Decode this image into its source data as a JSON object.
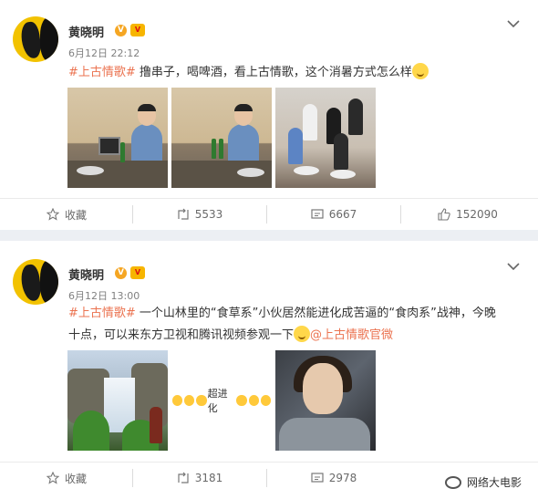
{
  "posts": [
    {
      "username": "黄晓明",
      "verified_badge": "V",
      "level_badge": "V",
      "timestamp": "6月12日 22:12",
      "hashtag": "#上古情歌#",
      "text": " 撸串子，喝啤酒，看上古情歌，这个消暑方式怎么样",
      "actions": {
        "favorite": "收藏",
        "repost": "5533",
        "comment": "6667",
        "like": "152090"
      }
    },
    {
      "username": "黄晓明",
      "verified_badge": "V",
      "level_badge": "V",
      "timestamp": "6月12日 13:00",
      "hashtag": "#上古情歌#",
      "text_line1": " 一个山林里的“食草系”小伙居然能进化成苦逼的“食肉系”战神，今晚",
      "text_line2": "十点，可以来东方卫视和腾讯视频参观一下",
      "mention": "@上古情歌官微",
      "evolve_label": "超进化",
      "actions": {
        "favorite": "收藏",
        "repost": "3181",
        "comment": "2978"
      }
    }
  ],
  "watermark": "网络大电影",
  "icons": {
    "favorite": "star-icon",
    "repost": "repost-icon",
    "comment": "comment-icon",
    "like": "thumbs-up-icon"
  },
  "colors": {
    "link": "#eb7350",
    "badge": "#f5a623",
    "background": "#eceff3"
  }
}
